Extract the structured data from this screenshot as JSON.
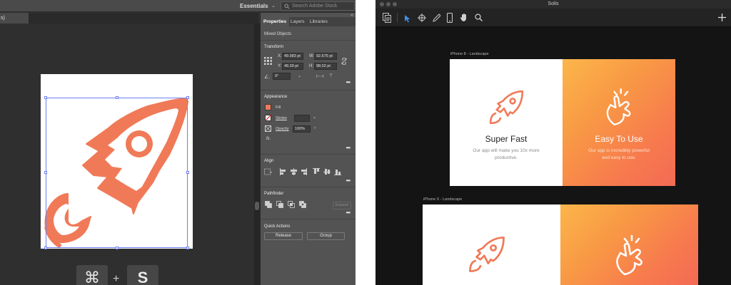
{
  "illustrator": {
    "workspace": "Essentials",
    "stock_search_placeholder": "Search Adobe Stock",
    "doc_tab": "s)",
    "panel_tabs": [
      "Properties",
      "Layers",
      "Libraries"
    ],
    "selection_type": "Mixed Objects",
    "transform": {
      "title": "Transform",
      "x_label": "X:",
      "x": "49.983 pt",
      "y_label": "Y:",
      "y": "49.39 pt",
      "w_label": "W:",
      "w": "92.675 pt",
      "h_label": "H:",
      "h": "98.02 pt",
      "angle": "0°"
    },
    "appearance": {
      "title": "Appearance",
      "fill_label": "Fill",
      "fill_color": "#f07a58",
      "stroke_label": "Stroke",
      "opacity_label": "Opacity",
      "opacity": "100%",
      "fx": "fx."
    },
    "align_title": "Align",
    "pathfinder": {
      "title": "Pathfinder",
      "expand_label": "Expand"
    },
    "quick_actions": {
      "title": "Quick Actions",
      "release_label": "Release",
      "group_label": "Group"
    },
    "shortcut": {
      "key1": "⌘",
      "plus": "+",
      "key2": "S"
    },
    "rocket_color": "#f07a58",
    "selection_color": "#6e80f0"
  },
  "app": {
    "title": "Solis",
    "artboards": [
      {
        "label": "iPhone 8 - Landscape",
        "left_title": "Super Fast",
        "left_sub_1": "Our app will make you 10x more",
        "left_sub_2": "productive.",
        "right_title": "Easy To Use",
        "right_sub_1": "Our app is incredibly powerful",
        "right_sub_2": "and easy to use."
      },
      {
        "label": "iPhone X - Landscape"
      }
    ],
    "accent_color": "#3d8ef0",
    "gradient_start": "#fcb64a",
    "gradient_end": "#f46a55",
    "icon_color": "#f07a58"
  }
}
